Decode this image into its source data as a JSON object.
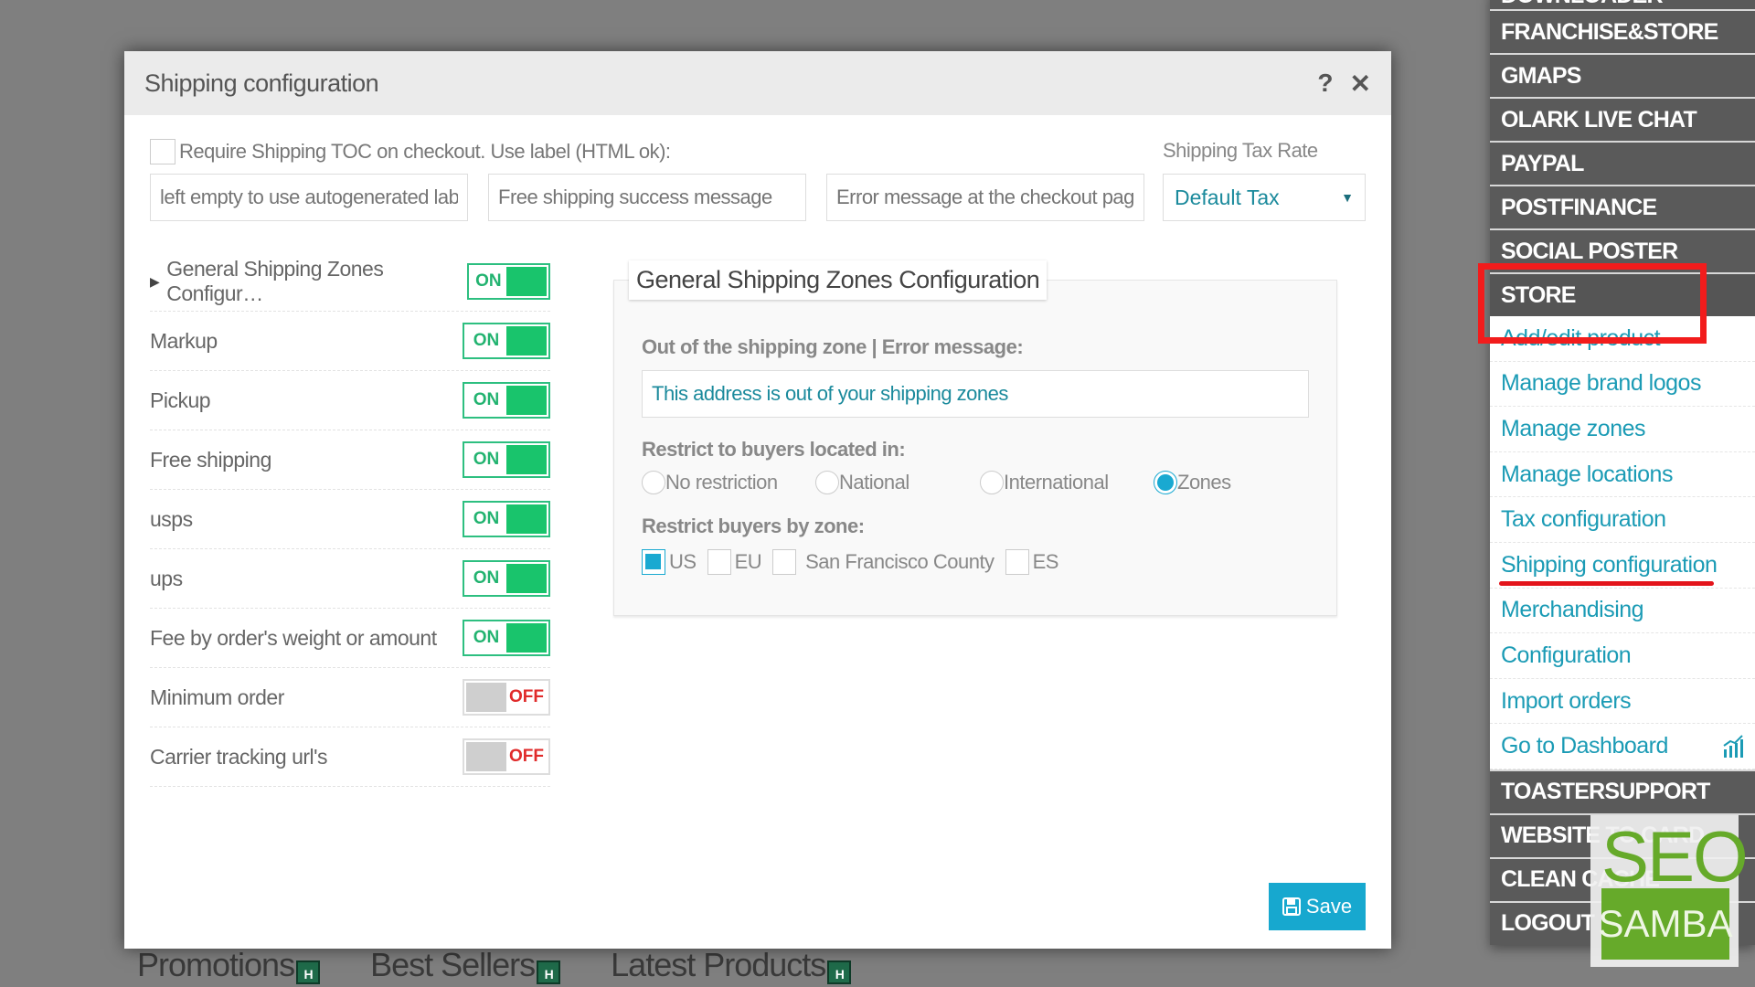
{
  "background": {
    "tabs": [
      {
        "label": "Promotions",
        "badge": "H"
      },
      {
        "label": "Best Sellers",
        "badge": "H"
      },
      {
        "label": "Latest Products",
        "badge": "H"
      }
    ]
  },
  "modal": {
    "title": "Shipping configuration",
    "help_icon": "?",
    "close_icon": "✕",
    "toc": {
      "label": "Require Shipping TOC on checkout. Use label (HTML ok):",
      "checked": false
    },
    "inputs": [
      {
        "placeholder": "left empty to use autogenerated label",
        "value": ""
      },
      {
        "placeholder": "Free shipping success message",
        "value": ""
      },
      {
        "placeholder": "Error message at the checkout page",
        "value": ""
      }
    ],
    "tax_rate": {
      "label": "Shipping Tax Rate",
      "selected": "Default Tax",
      "caret": "▼"
    },
    "toggles": [
      {
        "label": "General Shipping Zones Configur…",
        "state": "ON",
        "expandable": true
      },
      {
        "label": "Markup",
        "state": "ON"
      },
      {
        "label": "Pickup",
        "state": "ON"
      },
      {
        "label": "Free shipping",
        "state": "ON"
      },
      {
        "label": "usps",
        "state": "ON"
      },
      {
        "label": "ups",
        "state": "ON"
      },
      {
        "label": "Fee by order's weight or amount",
        "state": "ON"
      },
      {
        "label": "Minimum order",
        "state": "OFF"
      },
      {
        "label": "Carrier tracking url's",
        "state": "OFF"
      }
    ],
    "zone_panel": {
      "legend": "General Shipping Zones Configuration",
      "error_label": "Out of the shipping zone | Error message:",
      "error_value": "This address is out of your shipping zones",
      "restrict_label": "Restrict to buyers located in:",
      "restrict_options": [
        {
          "label": "No restriction",
          "checked": false
        },
        {
          "label": "National",
          "checked": false
        },
        {
          "label": "International",
          "checked": false
        },
        {
          "label": "Zones",
          "checked": true
        }
      ],
      "zone_label": "Restrict buyers by zone:",
      "zones": [
        {
          "label": "US",
          "checked": true
        },
        {
          "label": "EU",
          "checked": false
        },
        {
          "label": "San Francisco County",
          "checked": false
        },
        {
          "label": "ES",
          "checked": false
        }
      ]
    },
    "save_label": "Save"
  },
  "sidebar": {
    "items_top": [
      "DOWNLOADER",
      "FRANCHISE&STORE",
      "GMAPS",
      "OLARK LIVE CHAT",
      "PAYPAL",
      "POSTFINANCE",
      "SOCIAL POSTER"
    ],
    "active": "STORE",
    "sub_items": [
      "Add/edit product",
      "Manage brand logos",
      "Manage zones",
      "Manage locations",
      "Tax configuration",
      "Shipping configuration",
      "Merchandising",
      "Configuration",
      "Import orders",
      "Go to Dashboard"
    ],
    "highlighted_sub": "Shipping configuration",
    "items_bottom": [
      "TOASTERSUPPORT",
      "WEBSITE TO CARD",
      "CLEAN CACHE",
      "LOGOUT"
    ]
  },
  "watermark": {
    "top": "SEO",
    "bottom": "SAMBA"
  },
  "colors": {
    "accent": "#17a8cf",
    "on": "#19c46c",
    "off": "#e02b2b",
    "link": "#1b9bb5",
    "annotation": "#f21c1c",
    "logo": "#66aa2a"
  }
}
